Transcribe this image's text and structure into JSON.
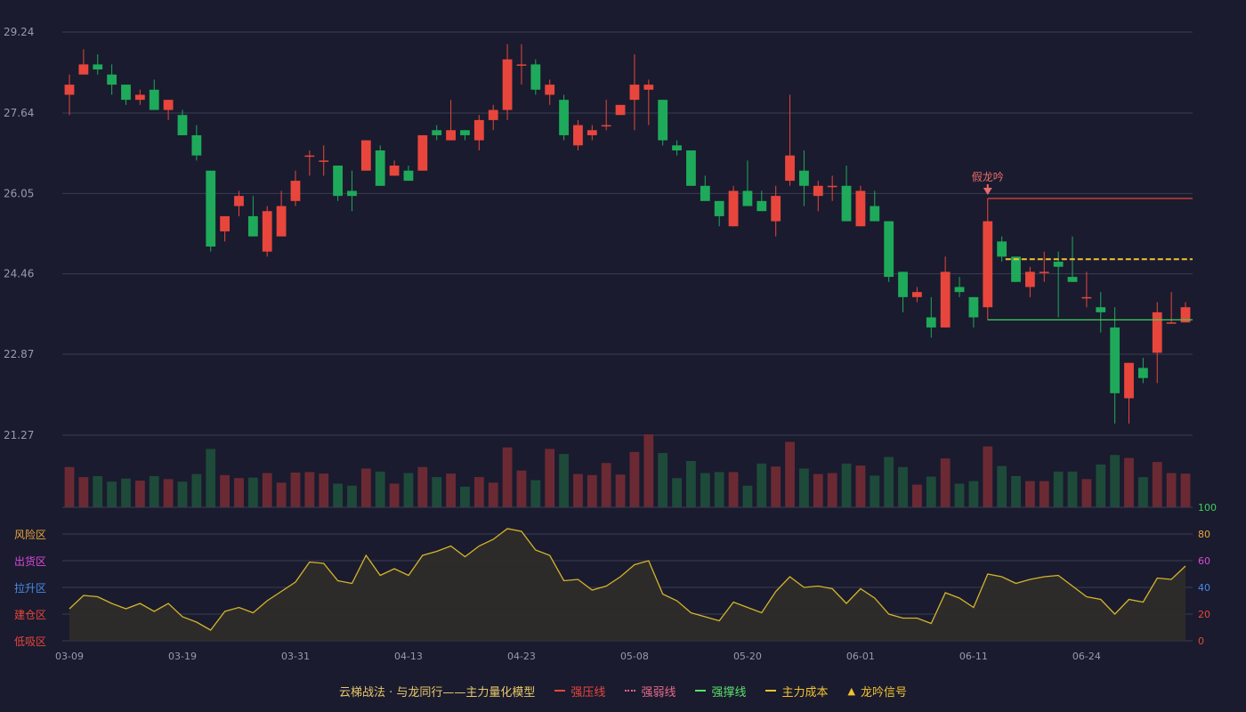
{
  "colors": {
    "background": "#1a1b2e",
    "up": "#e8463c",
    "down": "#1eaa5a",
    "up_volume": "#6b2a33",
    "down_volume": "#1e4a3a",
    "grid": "#3a3c52",
    "axis_text": "#9a9aae",
    "oscillator_line": "#d4b42a",
    "oscillator_fill": "#2e2c2a",
    "pressure_line": "#e8463c",
    "support_line": "#3ecf5a",
    "cost_line": "#f2c230",
    "signal": "#e86a6a"
  },
  "chart_data": [
    {
      "type": "candlestick",
      "name": "price",
      "y_ticks": [
        "29.24",
        "27.64",
        "26.05",
        "24.46",
        "22.87",
        "21.27"
      ],
      "ylim": [
        21.27,
        29.24
      ],
      "x_tick_labels": [
        "03-09",
        "03-19",
        "03-31",
        "04-13",
        "04-23",
        "05-08",
        "05-20",
        "06-01",
        "06-11",
        "06-24"
      ],
      "x_tick_indices": [
        0,
        8,
        16,
        24,
        32,
        40,
        48,
        56,
        64,
        72
      ],
      "ohlc": [
        [
          28.0,
          28.4,
          27.6,
          28.2
        ],
        [
          28.4,
          28.9,
          28.4,
          28.6
        ],
        [
          28.6,
          28.8,
          28.4,
          28.5
        ],
        [
          28.4,
          28.6,
          28.0,
          28.2
        ],
        [
          28.2,
          28.2,
          27.8,
          27.9
        ],
        [
          27.9,
          28.1,
          27.8,
          28.0
        ],
        [
          28.1,
          28.3,
          27.7,
          27.7
        ],
        [
          27.7,
          27.9,
          27.5,
          27.9
        ],
        [
          27.6,
          27.7,
          27.2,
          27.2
        ],
        [
          27.2,
          27.4,
          26.7,
          26.8
        ],
        [
          26.5,
          26.5,
          24.9,
          25.0
        ],
        [
          25.3,
          25.6,
          25.1,
          25.6
        ],
        [
          25.8,
          26.1,
          25.6,
          26.0
        ],
        [
          25.6,
          26.0,
          25.2,
          25.2
        ],
        [
          24.9,
          25.8,
          24.8,
          25.7
        ],
        [
          25.2,
          26.1,
          25.2,
          25.8
        ],
        [
          25.9,
          26.5,
          25.8,
          26.3
        ],
        [
          26.8,
          26.9,
          26.4,
          26.8
        ],
        [
          26.7,
          27.0,
          26.4,
          26.7
        ],
        [
          26.6,
          26.6,
          25.9,
          26.0
        ],
        [
          26.1,
          26.5,
          25.7,
          26.0
        ],
        [
          26.5,
          27.1,
          26.5,
          27.1
        ],
        [
          26.9,
          27.0,
          26.2,
          26.2
        ],
        [
          26.4,
          26.7,
          26.4,
          26.6
        ],
        [
          26.5,
          26.6,
          26.3,
          26.3
        ],
        [
          26.5,
          27.2,
          26.5,
          27.2
        ],
        [
          27.3,
          27.4,
          27.1,
          27.2
        ],
        [
          27.1,
          27.9,
          27.1,
          27.3
        ],
        [
          27.3,
          27.3,
          27.1,
          27.2
        ],
        [
          27.1,
          27.6,
          26.9,
          27.5
        ],
        [
          27.5,
          27.8,
          27.3,
          27.7
        ],
        [
          27.7,
          29.0,
          27.5,
          28.7
        ],
        [
          28.6,
          29.0,
          28.2,
          28.6
        ],
        [
          28.6,
          28.7,
          28.0,
          28.1
        ],
        [
          28.0,
          28.3,
          27.8,
          28.2
        ],
        [
          27.9,
          28.0,
          27.1,
          27.2
        ],
        [
          27.0,
          27.5,
          26.9,
          27.4
        ],
        [
          27.2,
          27.4,
          27.1,
          27.3
        ],
        [
          27.4,
          27.9,
          27.3,
          27.4
        ],
        [
          27.6,
          27.8,
          27.6,
          27.8
        ],
        [
          27.9,
          28.8,
          27.3,
          28.2
        ],
        [
          28.1,
          28.3,
          27.4,
          28.2
        ],
        [
          27.9,
          27.9,
          27.0,
          27.1
        ],
        [
          27.0,
          27.1,
          26.8,
          26.9
        ],
        [
          26.9,
          26.9,
          26.2,
          26.2
        ],
        [
          26.2,
          26.4,
          25.9,
          25.9
        ],
        [
          25.9,
          25.9,
          25.4,
          25.6
        ],
        [
          25.4,
          26.2,
          25.4,
          26.1
        ],
        [
          26.1,
          26.7,
          25.8,
          25.8
        ],
        [
          25.9,
          26.1,
          25.7,
          25.7
        ],
        [
          25.5,
          26.2,
          25.2,
          26.0
        ],
        [
          26.3,
          28.0,
          26.2,
          26.8
        ],
        [
          26.5,
          26.9,
          25.8,
          26.2
        ],
        [
          26.0,
          26.3,
          25.7,
          26.2
        ],
        [
          26.2,
          26.4,
          25.9,
          26.2
        ],
        [
          26.2,
          26.6,
          25.5,
          25.5
        ],
        [
          25.4,
          26.2,
          25.4,
          26.1
        ],
        [
          25.8,
          26.1,
          25.6,
          25.5
        ],
        [
          25.5,
          25.5,
          24.3,
          24.4
        ],
        [
          24.5,
          24.5,
          23.7,
          24.0
        ],
        [
          24.0,
          24.2,
          23.9,
          24.1
        ],
        [
          23.6,
          24.0,
          23.2,
          23.4
        ],
        [
          23.4,
          24.8,
          23.4,
          24.5
        ],
        [
          24.2,
          24.4,
          24.0,
          24.1
        ],
        [
          24.0,
          24.0,
          23.4,
          23.6
        ],
        [
          23.8,
          25.5,
          23.8,
          25.5
        ],
        [
          25.1,
          25.2,
          24.7,
          24.8
        ],
        [
          24.8,
          24.8,
          24.3,
          24.3
        ],
        [
          24.2,
          24.6,
          24.0,
          24.5
        ],
        [
          24.5,
          24.9,
          24.3,
          24.5
        ],
        [
          24.7,
          24.9,
          23.6,
          24.6
        ],
        [
          24.4,
          25.2,
          24.3,
          24.3
        ],
        [
          24.0,
          24.5,
          23.8,
          24.0
        ],
        [
          23.8,
          24.1,
          23.3,
          23.7
        ],
        [
          23.4,
          23.8,
          21.5,
          22.1
        ],
        [
          22.0,
          22.6,
          21.5,
          22.7
        ],
        [
          22.6,
          22.8,
          22.3,
          22.4
        ],
        [
          22.9,
          23.9,
          22.3,
          23.7
        ],
        [
          23.5,
          24.1,
          23.5,
          23.5
        ],
        [
          23.5,
          23.9,
          23.5,
          23.8
        ]
      ],
      "pressure_line": {
        "label": "强压线",
        "value": 25.95,
        "from_index": 65
      },
      "support_line": {
        "label": "强撑线",
        "value": 23.55,
        "from_index": 65
      },
      "cost_line": {
        "label": "主力成本",
        "value": 24.75,
        "from_index": 65
      },
      "signal": {
        "label": "假龙吟",
        "index": 65
      }
    },
    {
      "type": "bar",
      "name": "volume",
      "values": [
        80,
        60,
        62,
        51,
        57,
        53,
        62,
        56,
        51,
        66,
        116,
        64,
        58,
        59,
        68,
        49,
        69,
        70,
        67,
        47,
        43,
        77,
        71,
        47,
        68,
        80,
        60,
        67,
        41,
        60,
        49,
        119,
        73,
        54,
        116,
        106,
        66,
        64,
        88,
        65,
        110,
        145,
        108,
        58,
        92,
        68,
        70,
        70,
        43,
        87,
        81,
        130,
        77,
        66,
        68,
        87,
        83,
        63,
        100,
        80,
        45,
        61,
        97,
        47,
        52,
        121,
        82,
        62,
        52,
        52,
        71,
        71,
        56,
        85,
        104,
        98,
        60,
        90,
        68,
        67
      ]
    },
    {
      "type": "area",
      "name": "oscillator",
      "ylim": [
        0,
        100
      ],
      "y_ticks": [
        "100",
        "80",
        "60",
        "40",
        "20",
        "0"
      ],
      "zones": [
        "风险区",
        "出货区",
        "拉升区",
        "建仓区",
        "低吸区"
      ],
      "zone_colors": [
        "#e8a53c",
        "#d94ad9",
        "#4a8ae8",
        "#e8463c",
        "#e8463c"
      ],
      "right_tick_colors": [
        "#3ecf5a",
        "#e8a53c",
        "#d94ad9",
        "#4a8ae8",
        "#e8463c",
        "#e8463c"
      ],
      "values": [
        24,
        34,
        33,
        28,
        24,
        28,
        22,
        28,
        18,
        14,
        8,
        22,
        25,
        21,
        30,
        37,
        44,
        59,
        58,
        45,
        43,
        64,
        49,
        54,
        49,
        64,
        67,
        71,
        63,
        71,
        76,
        84,
        82,
        68,
        64,
        45,
        46,
        38,
        41,
        48,
        57,
        60,
        35,
        30,
        21,
        18,
        15,
        29,
        25,
        21,
        37,
        48,
        40,
        41,
        39,
        28,
        39,
        32,
        20,
        17,
        17,
        13,
        36,
        32,
        25,
        50,
        48,
        43,
        46,
        48,
        49,
        41,
        33,
        31,
        20,
        31,
        29,
        47,
        46,
        56
      ]
    }
  ],
  "legend": {
    "title": "云梯战法 · 与龙同行——主力量化模型",
    "pressure": "强压线",
    "weak": "强弱线",
    "support": "强撑线",
    "cost": "主力成本",
    "signal": "龙吟信号",
    "signal_glyph": "▲"
  }
}
